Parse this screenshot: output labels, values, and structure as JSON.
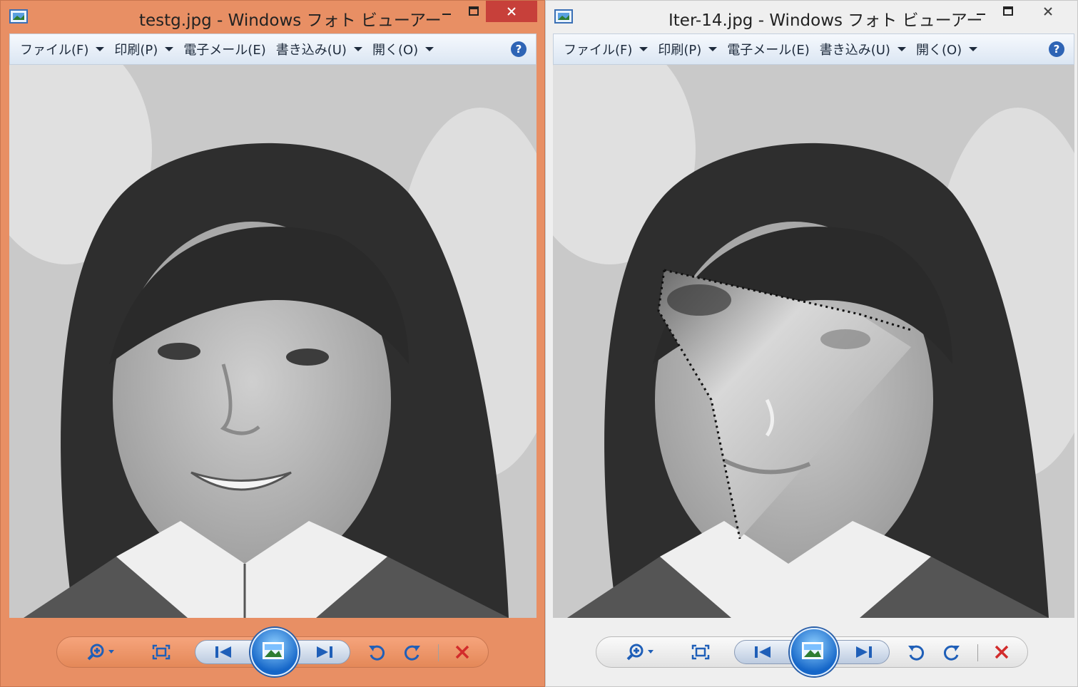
{
  "windows": [
    {
      "title": "testg.jpg - Windows フォト ビューアー",
      "menu": [
        {
          "label": "ファイル(F)",
          "has_dropdown": true
        },
        {
          "label": "印刷(P)",
          "has_dropdown": true
        },
        {
          "label": "電子メール(E)",
          "has_dropdown": false
        },
        {
          "label": "書き込み(U)",
          "has_dropdown": true
        },
        {
          "label": "開く(O)",
          "has_dropdown": true
        }
      ],
      "active": true,
      "frame_color": "#e88f64",
      "image_variant": "original"
    },
    {
      "title": "Iter-14.jpg - Windows フォト ビューアー",
      "menu": [
        {
          "label": "ファイル(F)",
          "has_dropdown": true
        },
        {
          "label": "印刷(P)",
          "has_dropdown": true
        },
        {
          "label": "電子メール(E)",
          "has_dropdown": false
        },
        {
          "label": "書き込み(U)",
          "has_dropdown": true
        },
        {
          "label": "開く(O)",
          "has_dropdown": true
        }
      ],
      "active": false,
      "frame_color": "#efefef",
      "image_variant": "face-swap-overlay"
    }
  ],
  "toolbar_icons": [
    "zoom-icon",
    "actual-size-icon",
    "previous-icon",
    "slideshow-icon",
    "next-icon",
    "rotate-left-icon",
    "rotate-right-icon",
    "delete-icon"
  ],
  "colors": {
    "close_active": "#c7403a",
    "delete_red": "#d22b2b",
    "nav_blue": "#1f5fb8"
  }
}
